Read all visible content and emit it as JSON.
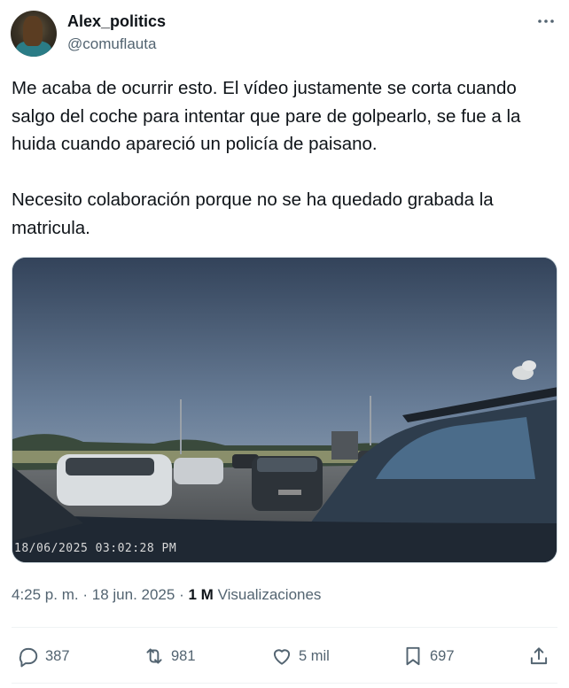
{
  "author": {
    "display_name": "Alex_politics",
    "handle": "@comuflauta"
  },
  "tweet": {
    "text": "Me acaba de ocurrir esto. El vídeo justamente se corta cuando salgo del coche para intentar que pare de golpearlo, se fue a la huida cuando apareció un policía de paisano.\n\nNecesito colaboración porque no se ha quedado grabada la matricula.",
    "media_timestamp": "18/06/2025 03:02:28 PM",
    "time": "4:25 p. m.",
    "date": "18 jun. 2025",
    "separator": "·",
    "views_count": "1 M",
    "views_label": "Visualizaciones"
  },
  "actions": {
    "replies": "387",
    "reposts": "981",
    "likes": "5 mil",
    "bookmarks": "697"
  },
  "colors": {
    "text": "#0f1419",
    "secondary": "#536471",
    "divider": "#eff3f4"
  }
}
